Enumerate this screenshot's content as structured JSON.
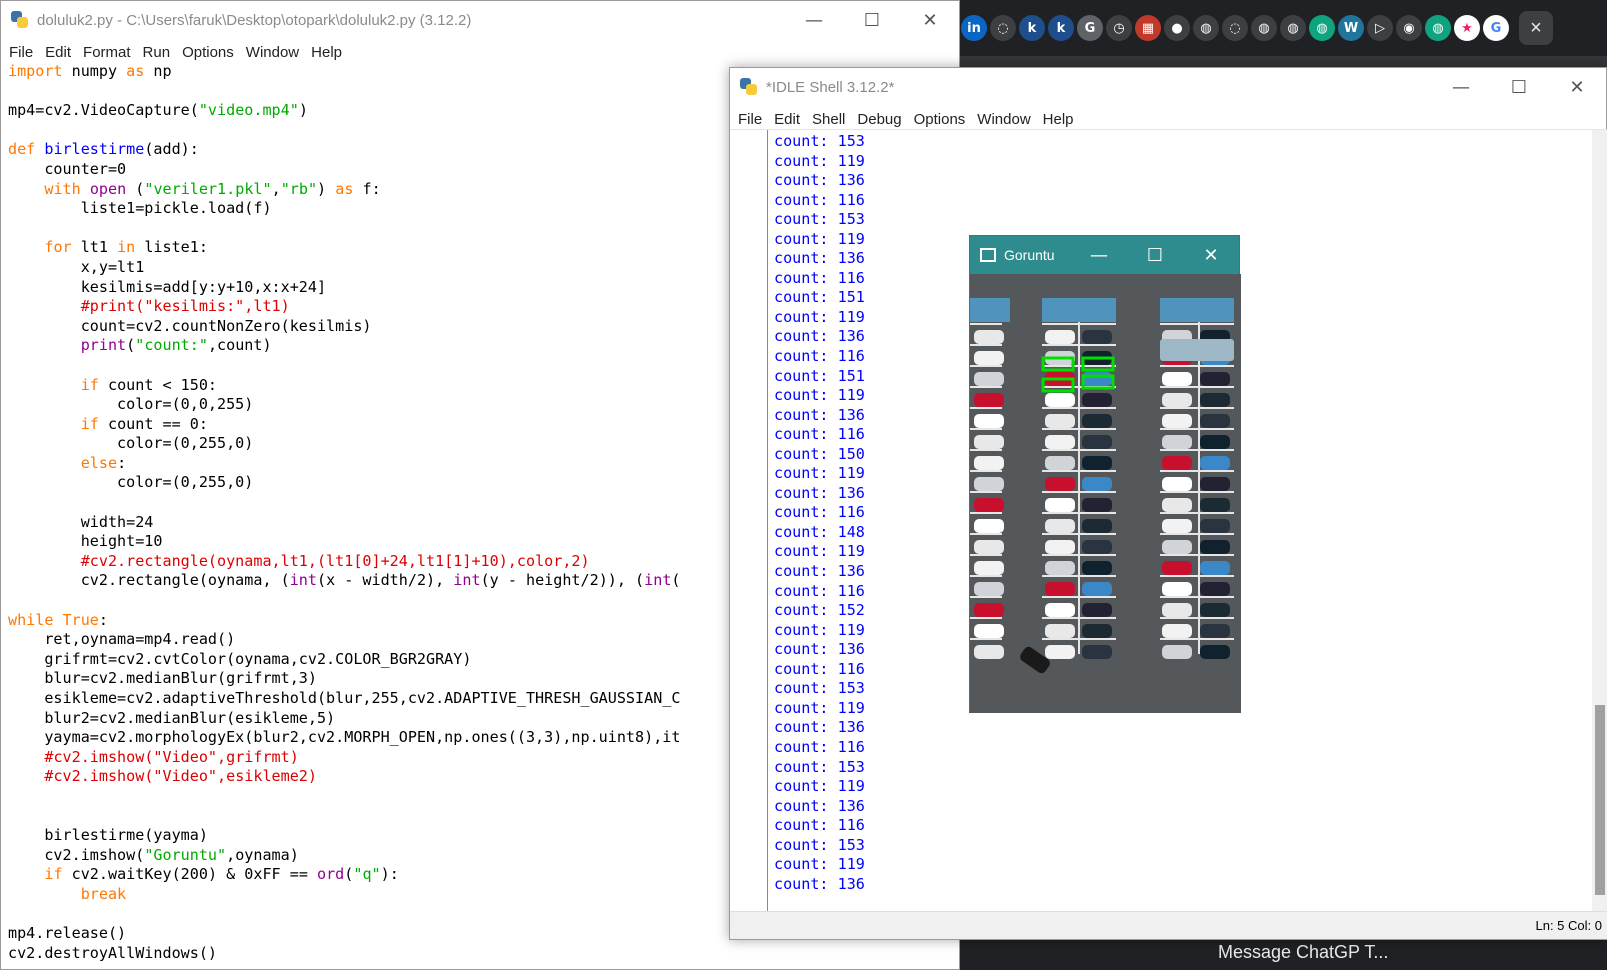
{
  "browser": {
    "tabs": [
      "in",
      "◌",
      "k",
      "k",
      "G",
      "◷",
      "▦",
      "●",
      "◍",
      "◌",
      "◍",
      "◍",
      "◍",
      "W",
      "▷",
      "◉",
      "◍",
      "★"
    ],
    "google_tab": "G",
    "close": "×",
    "bottom_text": "Message ChatGP T..."
  },
  "editor": {
    "title": "doluluk2.py - C:\\Users\\faruk\\Desktop\\otopark\\doluluk2.py (3.12.2)",
    "menu": [
      "File",
      "Edit",
      "Format",
      "Run",
      "Options",
      "Window",
      "Help"
    ],
    "buttons": {
      "minimize": "—",
      "maximize": "☐",
      "close": "✕"
    },
    "code_lines": [
      [
        [
          "kw",
          "import"
        ],
        [
          "n",
          " numpy "
        ],
        [
          "kw",
          "as"
        ],
        [
          "n",
          " np"
        ]
      ],
      [],
      [
        [
          "n",
          "mp4=cv2.VideoCapture("
        ],
        [
          "st",
          "\"video.mp4\""
        ],
        [
          "n",
          ")"
        ]
      ],
      [],
      [
        [
          "kw",
          "def"
        ],
        [
          "n",
          " "
        ],
        [
          "df",
          "birlestirme"
        ],
        [
          "n",
          "(add):"
        ]
      ],
      [
        [
          "n",
          "    counter=0"
        ]
      ],
      [
        [
          "n",
          "    "
        ],
        [
          "kw",
          "with"
        ],
        [
          "n",
          " "
        ],
        [
          "bi",
          "open"
        ],
        [
          "n",
          " ("
        ],
        [
          "st",
          "\"veriler1.pkl\""
        ],
        [
          "n",
          ","
        ],
        [
          "st",
          "\"rb\""
        ],
        [
          "n",
          ") "
        ],
        [
          "kw",
          "as"
        ],
        [
          "n",
          " f:"
        ]
      ],
      [
        [
          "n",
          "        liste1=pickle.load(f)"
        ]
      ],
      [],
      [
        [
          "n",
          "    "
        ],
        [
          "kw",
          "for"
        ],
        [
          "n",
          " lt1 "
        ],
        [
          "kw",
          "in"
        ],
        [
          "n",
          " liste1:"
        ]
      ],
      [
        [
          "n",
          "        x,y=lt1"
        ]
      ],
      [
        [
          "n",
          "        kesilmis=add[y:y+10,x:x+24]"
        ]
      ],
      [
        [
          "n",
          "        "
        ],
        [
          "cm",
          "#print(\"kesilmis:\",lt1)"
        ]
      ],
      [
        [
          "n",
          "        count=cv2.countNonZero(kesilmis)"
        ]
      ],
      [
        [
          "n",
          "        "
        ],
        [
          "bi",
          "print"
        ],
        [
          "n",
          "("
        ],
        [
          "st",
          "\"count:\""
        ],
        [
          "n",
          ",count)"
        ]
      ],
      [],
      [
        [
          "n",
          "        "
        ],
        [
          "kw",
          "if"
        ],
        [
          "n",
          " count < 150:"
        ]
      ],
      [
        [
          "n",
          "            color=(0,0,255)"
        ]
      ],
      [
        [
          "n",
          "        "
        ],
        [
          "kw",
          "if"
        ],
        [
          "n",
          " count == 0:"
        ]
      ],
      [
        [
          "n",
          "            color=(0,255,0)"
        ]
      ],
      [
        [
          "n",
          "        "
        ],
        [
          "kw",
          "else"
        ],
        [
          "n",
          ":"
        ]
      ],
      [
        [
          "n",
          "            color=(0,255,0)"
        ]
      ],
      [],
      [
        [
          "n",
          "        width=24"
        ]
      ],
      [
        [
          "n",
          "        height=10"
        ]
      ],
      [
        [
          "n",
          "        "
        ],
        [
          "cm",
          "#cv2.rectangle(oynama,lt1,(lt1[0]+24,lt1[1]+10),color,2)"
        ]
      ],
      [
        [
          "n",
          "        cv2.rectangle(oynama, ("
        ],
        [
          "bi",
          "int"
        ],
        [
          "n",
          "(x - width/2), "
        ],
        [
          "bi",
          "int"
        ],
        [
          "n",
          "(y - height/2)), ("
        ],
        [
          "bi",
          "int"
        ],
        [
          "n",
          "("
        ]
      ],
      [],
      [
        [
          "kw",
          "while"
        ],
        [
          "n",
          " "
        ],
        [
          "kw",
          "True"
        ],
        [
          "n",
          ":"
        ]
      ],
      [
        [
          "n",
          "    ret,oynama=mp4.read()"
        ]
      ],
      [
        [
          "n",
          "    grifrmt=cv2.cvtColor(oynama,cv2.COLOR_BGR2GRAY)"
        ]
      ],
      [
        [
          "n",
          "    blur=cv2.medianBlur(grifrmt,3)"
        ]
      ],
      [
        [
          "n",
          "    esikleme=cv2.adaptiveThreshold(blur,255,cv2.ADAPTIVE_THRESH_GAUSSIAN_C"
        ]
      ],
      [
        [
          "n",
          "    blur2=cv2.medianBlur(esikleme,5)"
        ]
      ],
      [
        [
          "n",
          "    yayma=cv2.morphologyEx(blur2,cv2.MORPH_OPEN,np.ones((3,3),np.uint8),it"
        ]
      ],
      [
        [
          "n",
          "    "
        ],
        [
          "cm",
          "#cv2.imshow(\"Video\",grifrmt)"
        ]
      ],
      [
        [
          "n",
          "    "
        ],
        [
          "cm",
          "#cv2.imshow(\"Video\",esikleme2)"
        ]
      ],
      [],
      [],
      [
        [
          "n",
          "    birlestirme(yayma)"
        ]
      ],
      [
        [
          "n",
          "    cv2.imshow("
        ],
        [
          "st",
          "\"Goruntu\""
        ],
        [
          "n",
          ",oynama)"
        ]
      ],
      [
        [
          "n",
          "    "
        ],
        [
          "kw",
          "if"
        ],
        [
          "n",
          " cv2.waitKey(200) & 0xFF == "
        ],
        [
          "bi",
          "ord"
        ],
        [
          "n",
          "("
        ],
        [
          "st",
          "\"q\""
        ],
        [
          "n",
          "):"
        ]
      ],
      [
        [
          "n",
          "        "
        ],
        [
          "kw",
          "break"
        ]
      ],
      [],
      [
        [
          "n",
          "mp4.release()"
        ]
      ],
      [
        [
          "n",
          "cv2.destroyAllWindows()"
        ]
      ]
    ]
  },
  "shell": {
    "title": "*IDLE Shell 3.12.2*",
    "menu": [
      "File",
      "Edit",
      "Shell",
      "Debug",
      "Options",
      "Window",
      "Help"
    ],
    "buttons": {
      "minimize": "—",
      "maximize": "☐",
      "close": "✕"
    },
    "lines": [
      "count: 153",
      "count: 119",
      "count: 136",
      "count: 116",
      "count: 153",
      "count: 119",
      "count: 136",
      "count: 116",
      "count: 151",
      "count: 119",
      "count: 136",
      "count: 116",
      "count: 151",
      "count: 119",
      "count: 136",
      "count: 116",
      "count: 150",
      "count: 119",
      "count: 136",
      "count: 116",
      "count: 148",
      "count: 119",
      "count: 136",
      "count: 116",
      "count: 152",
      "count: 119",
      "count: 136",
      "count: 116",
      "count: 153",
      "count: 119",
      "count: 136",
      "count: 116",
      "count: 153",
      "count: 119",
      "count: 136",
      "count: 116",
      "count: 153",
      "count: 119",
      "count: 136"
    ],
    "status": "Ln: 5   Col: 0"
  },
  "goruntu": {
    "title": "Goruntu",
    "buttons": {
      "minimize": "—",
      "maximize": "☐",
      "close": "✕"
    },
    "colors": {
      "asphalt": "#55585a",
      "line": "#e8e8e8",
      "box": "#00e000"
    }
  }
}
